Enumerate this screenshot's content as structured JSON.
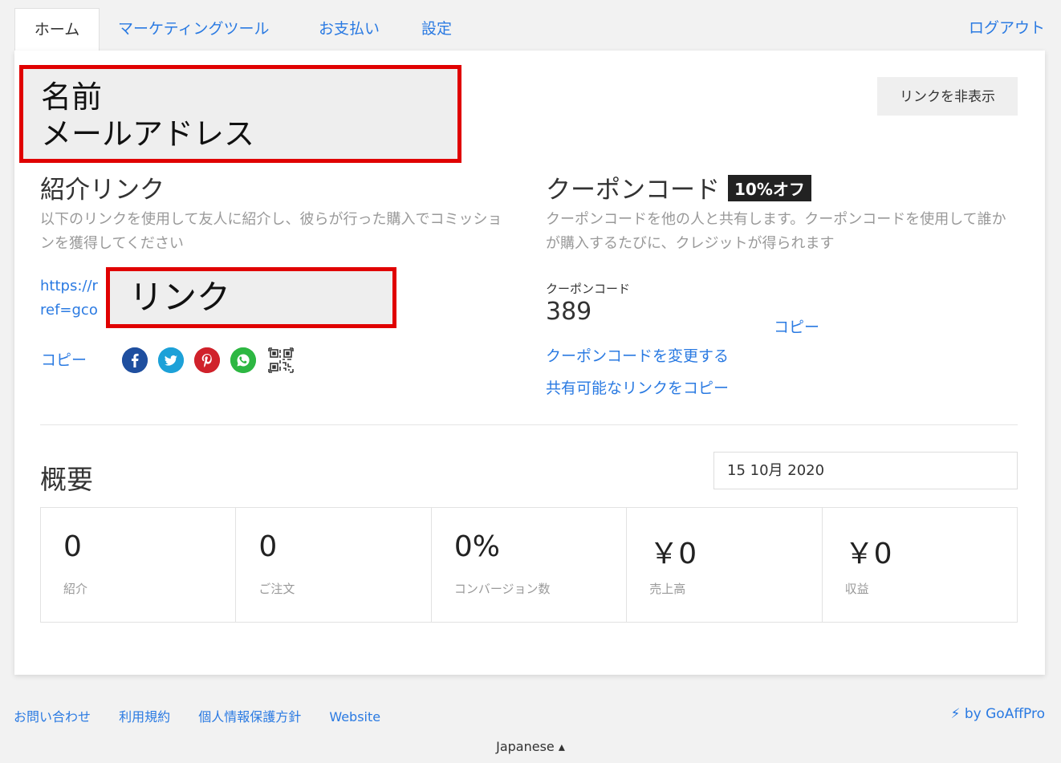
{
  "tabs": [
    {
      "label": "ホーム",
      "active": true
    },
    {
      "label": "マーケティングツール"
    },
    {
      "label": "お支払い"
    },
    {
      "label": "設定"
    }
  ],
  "logout_label": "ログアウト",
  "profile": {
    "name": "名前",
    "email": "メールアドレス"
  },
  "hide_links_label": "リンクを非表示",
  "referral": {
    "title": "紹介リンク",
    "description": "以下のリンクを使用して友人に紹介し、彼らが行った購入でコミッションを獲得してください",
    "url_line1": "https://r",
    "url_line2": "ref=gco",
    "redacted_label": "リンク",
    "copy_label": "コピー",
    "social": [
      {
        "icon": "facebook-icon",
        "color": "#1f4f9f",
        "glyph": "f"
      },
      {
        "icon": "twitter-icon",
        "color": "#1da1d8",
        "glyph": "t"
      },
      {
        "icon": "pinterest-icon",
        "color": "#d0222b",
        "glyph": "p"
      },
      {
        "icon": "whatsapp-icon",
        "color": "#2db742",
        "glyph": "w"
      },
      {
        "icon": "qr-code-icon"
      }
    ]
  },
  "coupon": {
    "title": "クーポンコード",
    "badge": "10%オフ",
    "description": "クーポンコードを他の人と共有します。クーポンコードを使用して誰かが購入するたびに、クレジットが得られます",
    "label": "クーポンコード",
    "value": "389",
    "copy_label": "コピー",
    "change_label": "クーポンコードを変更する",
    "copy_shareable_label": "共有可能なリンクをコピー"
  },
  "overview": {
    "title": "概要",
    "date": "15 10月 2020",
    "stats": [
      {
        "value": "0",
        "label": "紹介"
      },
      {
        "value": "0",
        "label": "ご注文"
      },
      {
        "value": "0%",
        "label": "コンバージョン数"
      },
      {
        "value": "￥0",
        "label": "売上高"
      },
      {
        "value": "￥0",
        "label": "収益"
      }
    ]
  },
  "footer": {
    "links": [
      "お問い合わせ",
      "利用規約",
      "個人情報保護方針",
      "Website"
    ],
    "powered_by": "by GoAffPro",
    "language": "Japanese"
  }
}
